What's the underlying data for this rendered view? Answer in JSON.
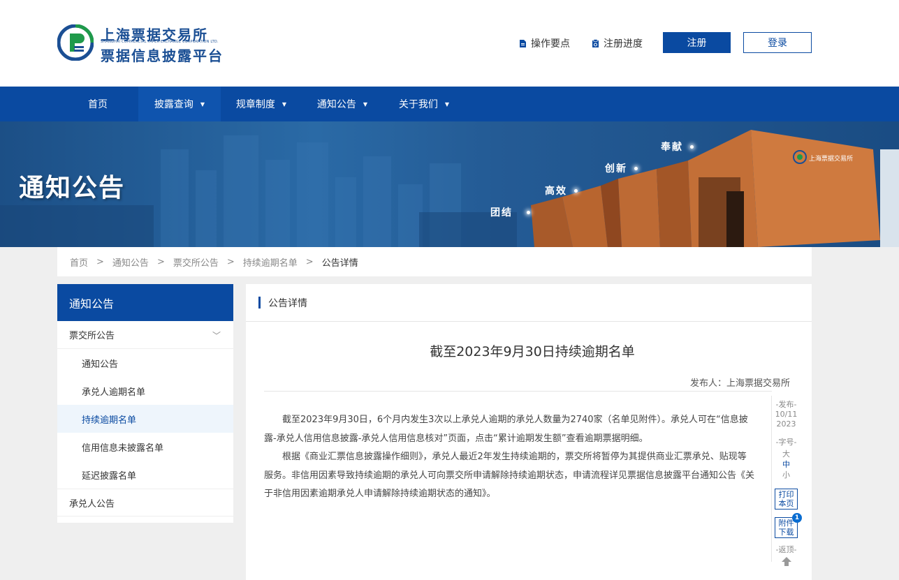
{
  "header": {
    "logo_line1": "上海票据交易所",
    "logo_sub": "SHANGHAI COMMERCIAL PAPER EXCHANGE CORPORATION LTD.",
    "logo_line2": "票据信息披露平台",
    "link_ops": "操作要点",
    "link_progress": "注册进度",
    "register_label": "注册",
    "login_label": "登录"
  },
  "nav": {
    "items": [
      {
        "label": "首页"
      },
      {
        "label": "披露查询"
      },
      {
        "label": "规章制度"
      },
      {
        "label": "通知公告"
      },
      {
        "label": "关于我们"
      }
    ]
  },
  "banner": {
    "title": "通知公告",
    "words": [
      "团结",
      "高效",
      "创新",
      "奉献"
    ],
    "building_sign": "上海票据交易所"
  },
  "breadcrumb": {
    "items": [
      "首页",
      "通知公告",
      "票交所公告",
      "持续逾期名单",
      "公告详情"
    ],
    "sep": ">"
  },
  "sidebar": {
    "title": "通知公告",
    "group1": "票交所公告",
    "subitems": [
      "通知公告",
      "承兑人逾期名单",
      "持续逾期名单",
      "信用信息未披露名单",
      "延迟披露名单"
    ],
    "group2": "承兑人公告"
  },
  "content": {
    "header": "公告详情",
    "title": "截至2023年9月30日持续逾期名单",
    "publisher": "发布人：上海票据交易所",
    "paragraphs": [
      "截至2023年9月30日，6个月内发生3次以上承兑人逾期的承兑人数量为2740家（名单见附件）。承兑人可在“信息披露-承兑人信用信息披露-承兑人信用信息核对”页面，点击“累计逾期发生额”查看逾期票据明细。",
      "根据《商业汇票信息披露操作细则》，承兑人最近2年发生持续逾期的，票交所将暂停为其提供商业汇票承兑、贴现等服务。非信用因素导致持续逾期的承兑人可向票交所申请解除持续逾期状态，申请流程详见票据信息披露平台通知公告《关于非信用因素逾期承兑人申请解除持续逾期状态的通知》。"
    ]
  },
  "tools": {
    "publish_label": "-发布-",
    "date_md": "10/11",
    "date_y": "2023",
    "fontsize_label": "-字号-",
    "size_large": "大",
    "size_medium": "中",
    "size_small": "小",
    "print_l1": "打印",
    "print_l2": "本页",
    "attach_l1": "附件",
    "attach_l2": "下载",
    "attach_count": "1",
    "top_label": "-返顶-"
  },
  "colors": {
    "primary": "#0a4aa1",
    "banner": "#245b95",
    "active_sub_bg": "#eef5fc"
  }
}
